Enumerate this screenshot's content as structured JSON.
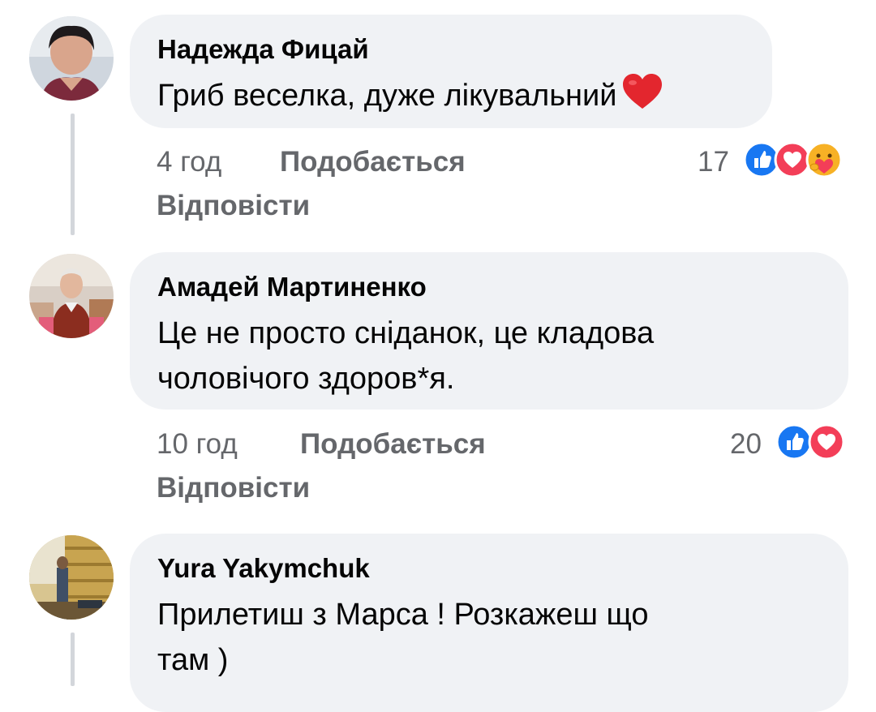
{
  "comments": [
    {
      "author": "Надежда Фицай",
      "text_lines": [
        "Гриб веселка, дуже лікувальний"
      ],
      "time": "4 год",
      "like_label": "Подобається",
      "reply_label": "Відповісти",
      "reaction_count": "17",
      "reactions": [
        "like-icon",
        "love-icon",
        "care-icon"
      ],
      "text_emoji": "heart-emoji"
    },
    {
      "author": "Амадей Мартиненко",
      "text_lines": [
        "Це не просто сніданок, це кладова",
        "чоловічого здоров*я."
      ],
      "time": "10 год",
      "like_label": "Подобається",
      "reply_label": "Відповісти",
      "reaction_count": "20",
      "reactions": [
        "like-icon",
        "love-icon"
      ]
    },
    {
      "author": "Yura Yakymchuk",
      "text_lines": [
        "Прилетиш з Марса ! Розкажеш що",
        "там )"
      ]
    }
  ],
  "colors": {
    "bubble": "#f0f2f5",
    "meta_text": "#65676b",
    "like_blue": "#1877f2",
    "love_red": "#f33e58",
    "thread_line": "#d3d6db"
  }
}
